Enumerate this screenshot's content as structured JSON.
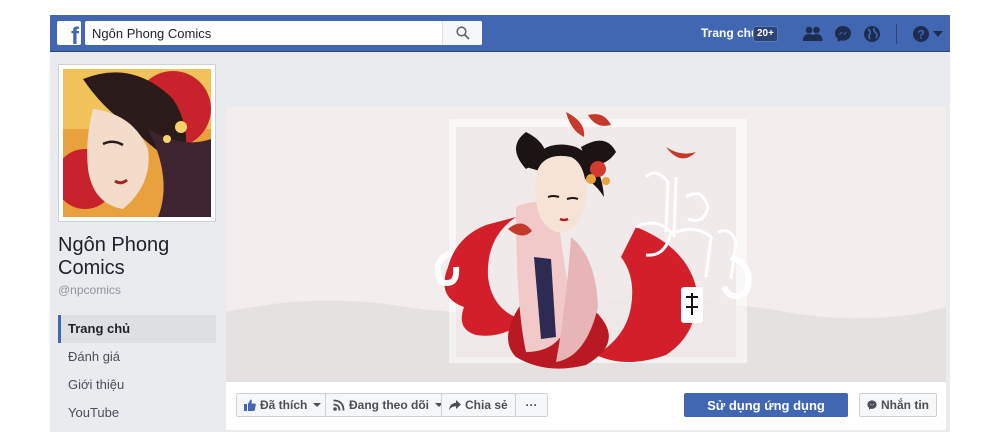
{
  "topbar": {
    "search_value": "Ngôn Phong Comics",
    "home_label": "Trang chủ",
    "home_badge": "20+",
    "icons": [
      "friend-requests-icon",
      "messenger-icon",
      "notifications-globe-icon",
      "help-icon",
      "account-menu-caret-icon"
    ]
  },
  "page": {
    "name": "Ngôn Phong Comics",
    "handle": "@npcomics"
  },
  "left_nav": {
    "items": [
      {
        "label": "Trang chủ",
        "active": true
      },
      {
        "label": "Đánh giá",
        "active": false
      },
      {
        "label": "Giới thiệu",
        "active": false
      },
      {
        "label": "YouTube",
        "active": false
      }
    ]
  },
  "actions": {
    "liked_label": "Đã thích",
    "following_label": "Đang theo dõi",
    "share_label": "Chia sẻ",
    "more_label": "···",
    "use_app_label": "Sử dụng ứng dụng",
    "message_label": "Nhắn tin"
  },
  "colors": {
    "brand_blue": "#4267b2",
    "bg_gray": "#e9ebee",
    "accent_red": "#c8232c"
  }
}
